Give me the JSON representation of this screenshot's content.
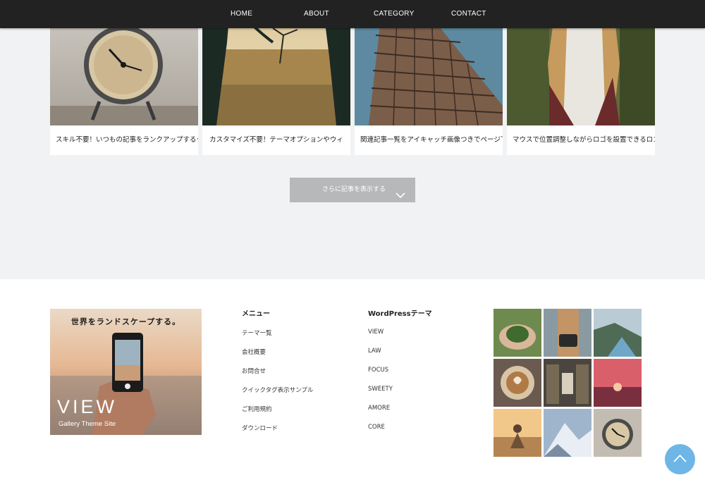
{
  "nav": {
    "items": [
      {
        "label": "HOME"
      },
      {
        "label": "ABOUT"
      },
      {
        "label": "CATEGORY"
      },
      {
        "label": "CONTACT"
      }
    ]
  },
  "posts": [
    {
      "title": "スキル不要！いつもの記事をランクアップするク",
      "image": "alarm-clock-photo"
    },
    {
      "title": "カスタマイズ不要！テーマオプションやウィ",
      "image": "dead-tree-landscape-photo"
    },
    {
      "title": "関連記事一覧をアイキャッチ画像つきでページ下",
      "image": "flatiron-building-photo"
    },
    {
      "title": "マウスで位置調整しながらロゴを設置できるロゴ",
      "image": "woman-portrait-photo"
    }
  ],
  "more_button": {
    "label": "さらに記事を表示する",
    "icon": "chevron-down-icon"
  },
  "footer": {
    "logo": {
      "tagline": "世界をランドスケープする。",
      "name": "VIEW",
      "subtitle": "Gallery Theme Site"
    },
    "menu": {
      "heading": "メニュー",
      "items": [
        "テーマ一覧",
        "会社概要",
        "お問合せ",
        "クイックタグ表示サンプル",
        "ご利用規約",
        "ダウンロード"
      ]
    },
    "themes": {
      "heading": "WordPressテーマ",
      "items": [
        "VIEW",
        "LAW",
        "FOCUS",
        "SWEETY",
        "AMORE",
        "CORE"
      ]
    },
    "gallery": [
      "hands-holding-leaves",
      "woman-with-camera",
      "fjord-landscape",
      "latte-art",
      "library-interior",
      "sunset-sea",
      "woman-sitting-sunset",
      "snowy-mountain",
      "alarm-clock"
    ]
  },
  "scroll_top": {
    "icon": "chevron-up-icon"
  },
  "colors": {
    "nav_bg": "#222222",
    "content_bg": "#f1f2f4",
    "button_bg": "#b7b8ba",
    "scroll_top_bg": "#6db6e6"
  }
}
